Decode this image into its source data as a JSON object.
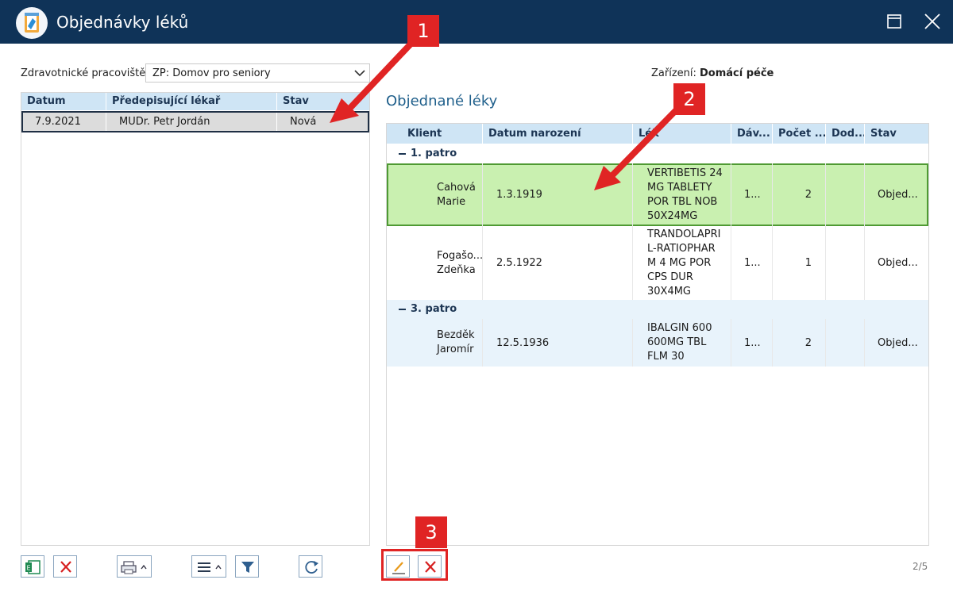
{
  "window": {
    "title": "Objednávky léků"
  },
  "left": {
    "workplace_label": "Zdravotnické pracoviště:",
    "workplace_value": "ZP: Domov pro seniory",
    "columns": [
      "Datum",
      "Předepisující lékař",
      "Stav"
    ],
    "rows": [
      {
        "date": "7.9.2021",
        "doctor": "MUDr. Petr Jordán",
        "status": "Nová"
      }
    ]
  },
  "right": {
    "facility_label": "Zařízení:",
    "facility_value": "Domácí péče",
    "title": "Objednané léky",
    "columns": [
      "Klient",
      "Datum narození",
      "Lék",
      "Dáv...",
      "Počet ...",
      "Dod...",
      "Stav"
    ],
    "groups": [
      {
        "label": "1. patro",
        "rows": [
          {
            "client_l1": "Cahová",
            "client_l2": "Marie",
            "dob": "1.3.1919",
            "drug": [
              "VERTIBETIS 24",
              "MG TABLETY",
              "POR TBL NOB",
              "50X24MG"
            ],
            "dose": "1...",
            "count": "2",
            "delivered": "",
            "status": "Objed..."
          },
          {
            "client_l1": "Fogašo...",
            "client_l2": "Zdeňka",
            "dob": "2.5.1922",
            "drug": [
              "TRANDOLAPRI",
              "L-RATIOPHAR",
              "M 4 MG POR",
              "CPS DUR",
              "30X4MG"
            ],
            "dose": "1...",
            "count": "1",
            "delivered": "",
            "status": "Objed..."
          }
        ]
      },
      {
        "label": "3. patro",
        "rows": [
          {
            "client_l1": "Bezděk",
            "client_l2": "Jaromír",
            "dob": "12.5.1936",
            "drug": [
              "IBALGIN 600",
              "600MG TBL",
              "FLM 30"
            ],
            "dose": "1...",
            "count": "2",
            "delivered": "",
            "status": "Objed..."
          }
        ]
      }
    ]
  },
  "toolbar": {
    "icons": [
      "excel-export-icon",
      "delete-icon",
      "print-icon",
      "menu-icon",
      "filter-icon",
      "refresh-icon",
      "edit-icon",
      "delete-icon"
    ]
  },
  "pager": "2/5",
  "annotations": {
    "badge1": "1",
    "badge2": "2",
    "badge3": "3",
    "color": "#e02424"
  },
  "colors": {
    "titlebar": "#0f3358",
    "header": "#cfe5f5",
    "selected_row": "#c9f0b0",
    "selected_border": "#4f9a33",
    "accent_text": "#1f5f8b"
  }
}
